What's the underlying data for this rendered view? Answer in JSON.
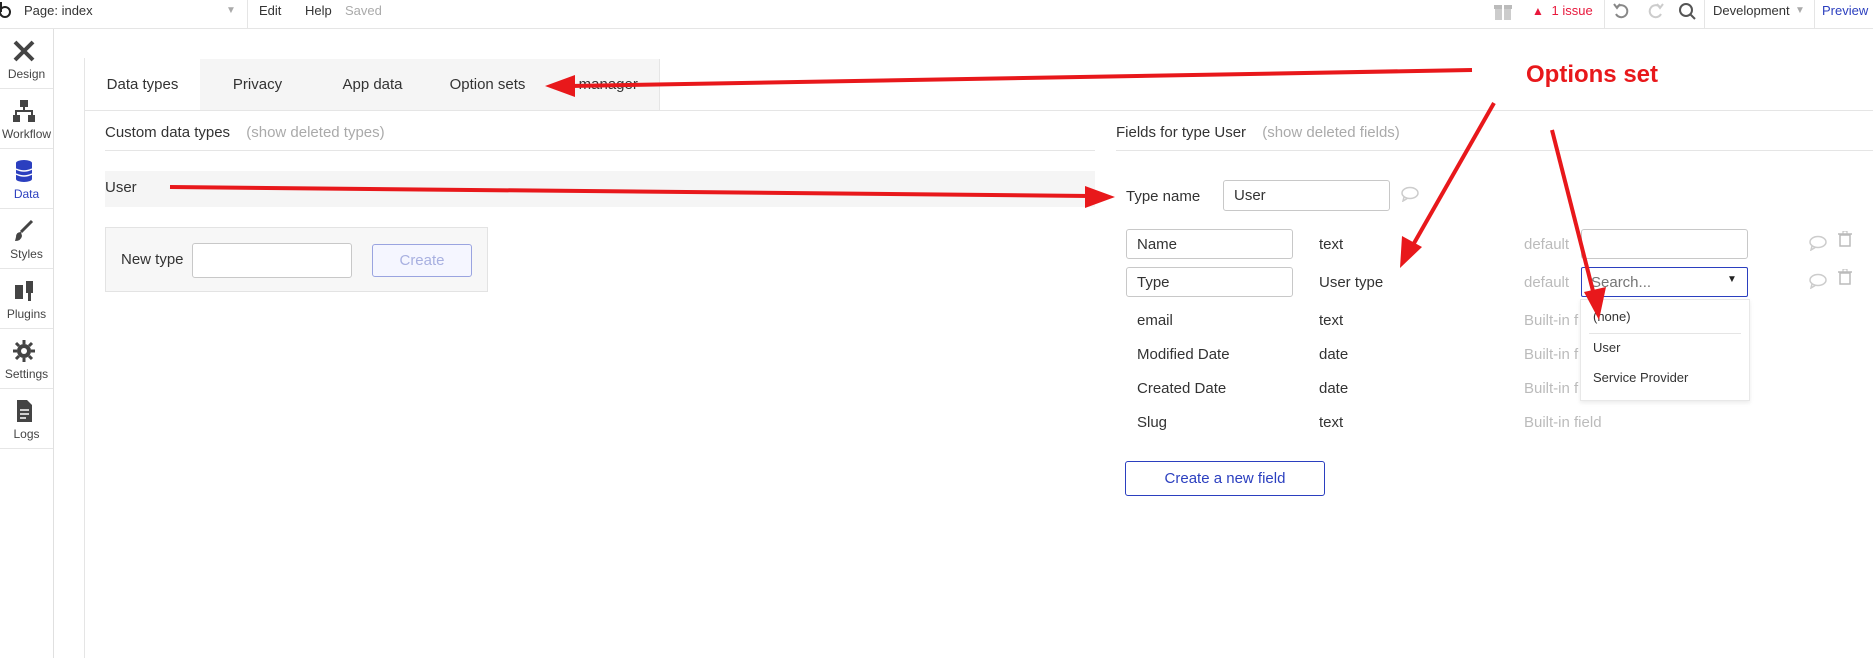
{
  "topbar": {
    "page_label": "Page: index",
    "menu_edit": "Edit",
    "menu_help": "Help",
    "save_status": "Saved",
    "issues": "1 issue",
    "environment": "Development",
    "preview": "Preview"
  },
  "sidebar": {
    "items": [
      {
        "label": "Design"
      },
      {
        "label": "Workflow"
      },
      {
        "label": "Data"
      },
      {
        "label": "Styles"
      },
      {
        "label": "Plugins"
      },
      {
        "label": "Settings"
      },
      {
        "label": "Logs"
      }
    ]
  },
  "tabs": [
    "Data types",
    "Privacy",
    "App data",
    "Option sets",
    "e manager"
  ],
  "left_panel": {
    "heading": "Custom data types",
    "show_deleted": "(show deleted types)",
    "type_item": "User",
    "new_type_label": "New type",
    "create_button": "Create"
  },
  "right_panel": {
    "heading": "Fields for type User",
    "show_deleted": "(show deleted fields)",
    "type_name_label": "Type name",
    "type_name_value": "User",
    "fields": [
      {
        "name": "Name",
        "type": "text",
        "default": "default"
      },
      {
        "name": "Type",
        "type": "User type",
        "default": "default"
      },
      {
        "name": "email",
        "type": "text",
        "default": "Built-in f"
      },
      {
        "name": "Modified Date",
        "type": "date",
        "default": "Built-in f"
      },
      {
        "name": "Created Date",
        "type": "date",
        "default": "Built-in f"
      },
      {
        "name": "Slug",
        "type": "text",
        "default": "Built-in field"
      }
    ],
    "search_placeholder": "Search...",
    "dropdown_options": [
      "(none)",
      "User",
      "Service Provider"
    ],
    "create_field_button": "Create a new field"
  },
  "annotation": {
    "text": "Options set",
    "color": "#e8181b"
  },
  "colors": {
    "accent": "#2b3fbf",
    "issue": "#e8183c",
    "annotation": "#e8181b"
  }
}
